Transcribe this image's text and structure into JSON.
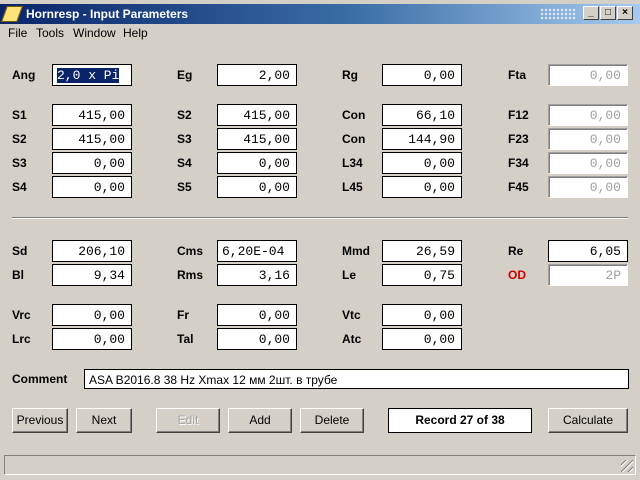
{
  "window": {
    "title": "Hornresp - Input Parameters"
  },
  "menu": {
    "file": "File",
    "tools": "Tools",
    "window": "Window",
    "help": "Help"
  },
  "labels": {
    "ang": "Ang",
    "eg": "Eg",
    "rg": "Rg",
    "fta": "Fta",
    "s1a": "S1",
    "s2b": "S2",
    "con1": "Con",
    "f12": "F12",
    "s2a": "S2",
    "s3b": "S3",
    "con2": "Con",
    "f23": "F23",
    "s3a": "S3",
    "s4b": "S4",
    "l34": "L34",
    "f34": "F34",
    "s4a": "S4",
    "s5b": "S5",
    "l45": "L45",
    "f45": "F45",
    "sd": "Sd",
    "cms": "Cms",
    "mmd": "Mmd",
    "re": "Re",
    "bl": "Bl",
    "rms": "Rms",
    "le": "Le",
    "od": "OD",
    "vrc": "Vrc",
    "fr": "Fr",
    "vtc": "Vtc",
    "lrc": "Lrc",
    "tal": "Tal",
    "atc": "Atc",
    "comment": "Comment"
  },
  "values": {
    "ang": "2,0 x Pi",
    "eg": "2,00",
    "rg": "0,00",
    "fta": "0,00",
    "s1": "415,00",
    "s2b": "415,00",
    "con1": "66,10",
    "f12": "0,00",
    "s2": "415,00",
    "s3b": "415,00",
    "con2": "144,90",
    "f23": "0,00",
    "s3": "0,00",
    "s4b": "0,00",
    "l34": "0,00",
    "f34": "0,00",
    "s4": "0,00",
    "s5b": "0,00",
    "l45": "0,00",
    "f45": "0,00",
    "sd": "206,10",
    "cms": "6,20E-04",
    "mmd": "26,59",
    "re": "6,05",
    "bl": "9,34",
    "rms": "3,16",
    "le": "0,75",
    "od": "2P",
    "vrc": "0,00",
    "fr": "0,00",
    "vtc": "0,00",
    "lrc": "0,00",
    "tal": "0,00",
    "atc": "0,00",
    "comment": "ASA B2016.8 38 Hz Xmax 12 мм 2шт. в трубе"
  },
  "buttons": {
    "previous": "Previous",
    "next": "Next",
    "edit": "Edit",
    "add": "Add",
    "delete": "Delete",
    "calculate": "Calculate"
  },
  "record": "Record 27 of 38",
  "colors": {
    "title_start": "#0a246a",
    "title_end": "#a6caf0",
    "od_label": "#cc0000",
    "selection": "#0a246a"
  }
}
